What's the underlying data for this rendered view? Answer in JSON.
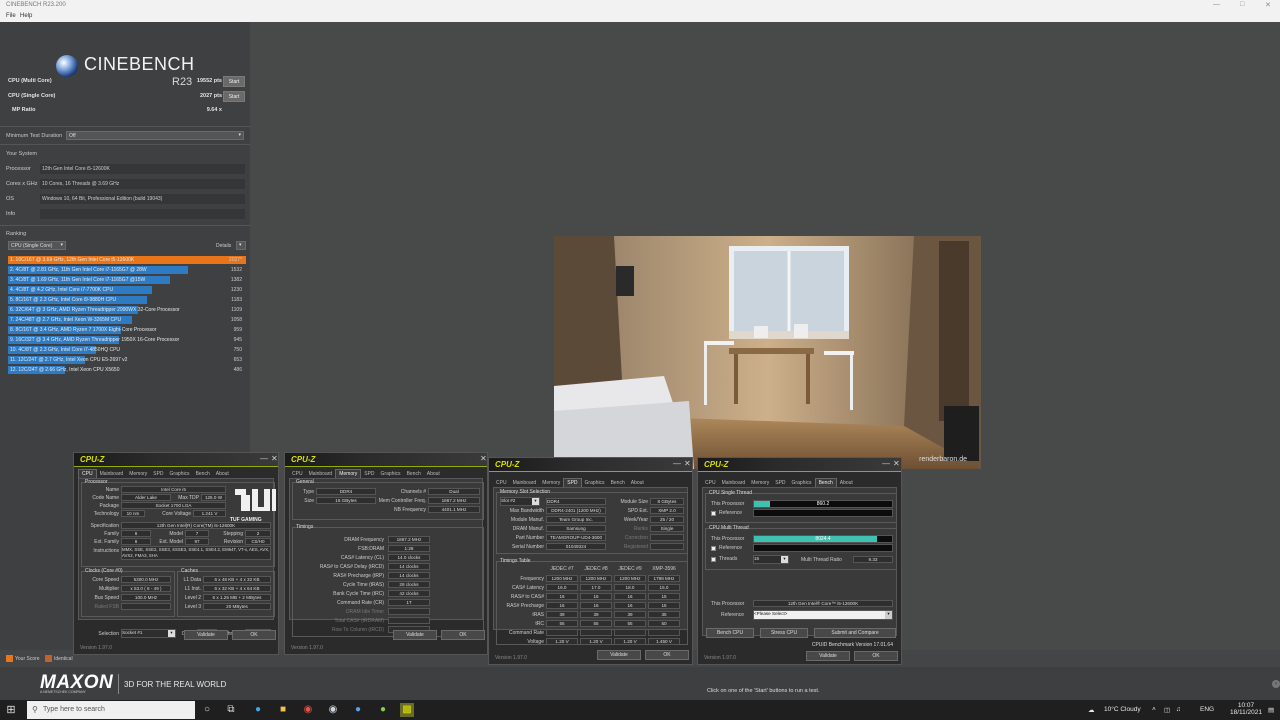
{
  "window": {
    "title": "CINEBENCH R23.200",
    "menu": [
      "File",
      "Help"
    ]
  },
  "logo": {
    "brand": "CINEBENCH",
    "version": "R23"
  },
  "scores": {
    "multi": {
      "label": "CPU (Multi Core)",
      "value": "19552 pts",
      "button": "Start"
    },
    "single": {
      "label": "CPU (Single Core)",
      "value": "2027 pts",
      "button": "Start"
    },
    "ratio": {
      "label": "MP Ratio",
      "value": "9.64 x"
    }
  },
  "min_duration": {
    "label": "Minimum Test Duration",
    "value": "Off"
  },
  "system": {
    "title": "Your System",
    "rows": [
      {
        "k": "Processor",
        "v": "12th Gen Intel Core i5-12600K"
      },
      {
        "k": "Cores x GHz",
        "v": "10 Cores, 16 Threads @ 3.69 GHz"
      },
      {
        "k": "OS",
        "v": "Windows 10, 64 Bit, Professional Edition (build 19043)"
      },
      {
        "k": "Info",
        "v": ""
      }
    ]
  },
  "ranking": {
    "title": "Ranking",
    "mode": "CPU (Single Core)",
    "details": "Details",
    "items": [
      {
        "label": "1. 10C/16T @ 3.69 GHz, 12th Gen Intel Core i5-12600K",
        "score": "2027*",
        "frac": 1.0,
        "color": "#e8751a"
      },
      {
        "label": "2. 4C/8T @ 2.81 GHz, 11th Gen Intel Core i7-1165G7 @ 28W",
        "score": "1532",
        "frac": 0.756,
        "color": "#2e7bc4"
      },
      {
        "label": "3. 4C/8T @ 1.69 GHz, 11th Gen Intel Core i7-1165G7 @15W",
        "score": "1382",
        "frac": 0.682,
        "color": "#2e7bc4"
      },
      {
        "label": "4. 4C/8T @ 4.2 GHz, Intel Core i7-7700K CPU",
        "score": "1230",
        "frac": 0.607,
        "color": "#2e7bc4"
      },
      {
        "label": "5. 8C/16T @ 2.3 GHz, Intel Core i9-9880H CPU",
        "score": "1183",
        "frac": 0.584,
        "color": "#2e7bc4"
      },
      {
        "label": "6. 32C/64T @ 3 GHz, AMD Ryzen Threadripper 2990WX 32-Core Processor",
        "score": "1109",
        "frac": 0.547,
        "color": "#2e7bc4"
      },
      {
        "label": "7. 24C/48T @ 2.7 GHz, Intel Xeon W-3265M CPU",
        "score": "1058",
        "frac": 0.522,
        "color": "#2e7bc4"
      },
      {
        "label": "8. 8C/16T @ 3.4 GHz, AMD Ryzen 7 1700X Eight-Core Processor",
        "score": "959",
        "frac": 0.473,
        "color": "#2e7bc4"
      },
      {
        "label": "9. 16C/32T @ 3.4 GHz, AMD Ryzen Threadripper 1950X 16-Core Processor",
        "score": "945",
        "frac": 0.466,
        "color": "#2e7bc4"
      },
      {
        "label": "10. 4C/8T @ 2.3 GHz, Intel Core i7-4850HQ CPU",
        "score": "750",
        "frac": 0.37,
        "color": "#2e7bc4"
      },
      {
        "label": "11. 12C/24T @ 2.7 GHz, Intel Xeon CPU E5-2697 v2",
        "score": "653",
        "frac": 0.322,
        "color": "#2e7bc4"
      },
      {
        "label": "12. 12C/24T @ 2.66 GHz, Intel Xeon CPU X5650",
        "score": "486",
        "frac": 0.24,
        "color": "#2e7bc4"
      }
    ]
  },
  "legend": {
    "your_score": "Your Score",
    "identical": "Identical",
    "your_color": "#e8751a",
    "identical_color": "#c0622a"
  },
  "render": {
    "watermark": "renderbaron.de"
  },
  "cpuz_cpu": {
    "title": "CPU-Z",
    "tabs": [
      "CPU",
      "Mainboard",
      "Memory",
      "SPD",
      "Graphics",
      "Bench",
      "About"
    ],
    "active": "CPU",
    "processor_title": "Processor",
    "name_l": "Name",
    "name": "Intel Core i5",
    "code_l": "Code Name",
    "code": "Alder Lake",
    "tdp_l": "Max TDP",
    "tdp": "125.0 W",
    "pkg_l": "Package",
    "pkg": "Socket 1700 LGA",
    "tech_l": "Technology",
    "tech": "10 nm",
    "volt_l": "Core Voltage",
    "volt": "1.241 V",
    "spec_l": "Specification",
    "spec": "12th Gen Intel(R) Core(TM) i5-12600K",
    "fam_l": "Family",
    "fam": "6",
    "model_l": "Model",
    "model": "7",
    "step_l": "Stepping",
    "step": "2",
    "efam_l": "Ext. Family",
    "efam": "6",
    "emodel_l": "Ext. Model",
    "emodel": "97",
    "rev_l": "Revision",
    "rev": "C0/H0",
    "inst_l": "Instructions",
    "inst": "MMX, SSE, SSE2, SSE3, SSSE3, SSE4.1, SSE4.2, EM64T, VT-x, AES, AVX, AVX2, FMA3, SHA",
    "clocks_title": "Clocks (Core #0)",
    "speed_l": "Core Speed",
    "speed": "5300.0 MHz",
    "mult_l": "Multiplier",
    "mult": "x 53.0 ( 8 - 49 )",
    "bus_l": "Bus Speed",
    "bus": "100.0 MHz",
    "fsb_l": "Rated FSB",
    "fsb": "",
    "caches_title": "Caches",
    "l1d_l": "L1 Data",
    "l1d": "6 x 48 KB + 4 x 32 KB",
    "l1i_l": "L1 Inst.",
    "l1i": "6 x 32 KB + 4 x 64 KB",
    "l2_l": "Level 2",
    "l2": "6 x 1.25 MB + 2 MBytes",
    "l3_l": "Level 3",
    "l3": "20 MBytes",
    "sel_l": "Selection",
    "sel": "Socket #1",
    "cores_l": "Cores",
    "cores": "6 + 4",
    "threads_l": "Threads",
    "threads": "16",
    "validate": "Validate",
    "ok": "OK",
    "version": "Version 1.97.0",
    "badge": "TUF GAMING"
  },
  "cpuz_mem": {
    "title": "CPU-Z",
    "tabs": [
      "CPU",
      "Mainboard",
      "Memory",
      "SPD",
      "Graphics",
      "Bench",
      "About"
    ],
    "active": "Memory",
    "general_title": "General",
    "type_l": "Type",
    "type": "DDR4",
    "ch_l": "Channels #",
    "ch": "Dual",
    "size_l": "Size",
    "size": "16 GBytes",
    "mcf_l": "Mem Controller Freq.",
    "mcf": "1867.2 MHz",
    "nbf_l": "NB Frequency",
    "nbf": "4401.1 MHz",
    "timings_title": "Timings",
    "rows": [
      {
        "l": "DRAM Frequency",
        "v": "1867.2 MHz"
      },
      {
        "l": "FSB:DRAM",
        "v": "1:28"
      },
      {
        "l": "CAS# Latency (CL)",
        "v": "14.0 clocks"
      },
      {
        "l": "RAS# to CAS# Delay (tRCD)",
        "v": "14 clocks"
      },
      {
        "l": "RAS# Precharge (tRP)",
        "v": "14 clocks"
      },
      {
        "l": "Cycle Time (tRAS)",
        "v": "28 clocks"
      },
      {
        "l": "Bank Cycle Time (tRC)",
        "v": "42 clocks"
      },
      {
        "l": "Command Rate (CR)",
        "v": "1T"
      },
      {
        "l": "DRAM Idle Timer",
        "v": ""
      },
      {
        "l": "Total CAS# (tRDRAM)",
        "v": ""
      },
      {
        "l": "Row To Column (tRCD)",
        "v": ""
      }
    ],
    "validate": "Validate",
    "ok": "OK",
    "version": "Version 1.97.0"
  },
  "cpuz_spd": {
    "title": "CPU-Z",
    "tabs": [
      "CPU",
      "Mainboard",
      "Memory",
      "SPD",
      "Graphics",
      "Bench",
      "About"
    ],
    "active": "SPD",
    "slot_title": "Memory Slot Selection",
    "slot": "Slot #2",
    "slot_type": "DDR4",
    "modsize_l": "Module Size",
    "modsize": "8 GBytes",
    "maxbw_l": "Max Bandwidth",
    "maxbw": "DDR4-2401 (1200 MHz)",
    "spdext_l": "SPD Ext.",
    "spdext": "XMP 2.0",
    "modman_l": "Module Manuf.",
    "modman": "Team Group Inc.",
    "wy_l": "Week/Year",
    "wy": "25 / 20",
    "dram_l": "DRAM Manuf.",
    "dram": "Samsung",
    "ranks_l": "Ranks",
    "ranks": "Single",
    "part_l": "Part Number",
    "part": "TEAMGROUP-UD4-3600",
    "corr_l": "Correction",
    "corr": "",
    "serial_l": "Serial Number",
    "serial": "01049324",
    "reg_l": "Registered",
    "reg": "",
    "tt_title": "Timings Table",
    "cols": [
      "JEDEC #7",
      "JEDEC #8",
      "JEDEC #9",
      "XMP-3596"
    ],
    "trows": [
      {
        "l": "Frequency",
        "v": [
          "1200 MHz",
          "1200 MHz",
          "1200 MHz",
          "1798 MHz"
        ]
      },
      {
        "l": "CAS# Latency",
        "v": [
          "16.0",
          "17.0",
          "18.0",
          "15.0"
        ]
      },
      {
        "l": "RAS# to CAS#",
        "v": [
          "16",
          "16",
          "16",
          "15"
        ]
      },
      {
        "l": "RAS# Precharge",
        "v": [
          "16",
          "16",
          "16",
          "15"
        ]
      },
      {
        "l": "tRAS",
        "v": [
          "39",
          "39",
          "39",
          "35"
        ]
      },
      {
        "l": "tRC",
        "v": [
          "55",
          "55",
          "55",
          "50"
        ]
      },
      {
        "l": "Command Rate",
        "v": [
          "",
          "",
          "",
          ""
        ]
      },
      {
        "l": "Voltage",
        "v": [
          "1.20 V",
          "1.20 V",
          "1.20 V",
          "1.450 V"
        ]
      }
    ],
    "validate": "Validate",
    "ok": "OK",
    "version": "Version 1.97.0"
  },
  "cpuz_bench": {
    "title": "CPU-Z",
    "tabs": [
      "CPU",
      "Mainboard",
      "Memory",
      "SPD",
      "Graphics",
      "Bench",
      "About"
    ],
    "active": "Bench",
    "st_title": "CPU Single Thread",
    "this_l": "This Processor",
    "st": "860.2",
    "st_frac": 0.115,
    "ref_l": "Reference",
    "mt_title": "CPU Multi Thread",
    "mt": "8024.4",
    "mt_frac": 0.89,
    "threads_l": "Threads",
    "threads": "16",
    "mtr_l": "Multi Thread Ratio",
    "mtr": "9.33",
    "tp_l": "This Processor",
    "tp": "12th Gen Intel® Core™ i5-12600K",
    "rs_l": "Reference",
    "rs": "<Please Select>",
    "bench_btn": "Bench CPU",
    "stress_btn": "Stress CPU",
    "submit_btn": "Submit and Compare",
    "bver": "CPUID Benchmark Version 17.01.64",
    "validate": "Validate",
    "ok": "OK",
    "version": "Version 1.97.0",
    "bar_color": "#40c0b0"
  },
  "footer": {
    "brand": "MAXON",
    "sub": "A NEMETSCHEK COMPANY",
    "tagline": "3D FOR THE REAL WORLD",
    "hint": "Click on one of the 'Start' buttons to run a test."
  },
  "taskbar": {
    "search": "Type here to search",
    "weather": "10°C Cloudy",
    "lang": "ENG",
    "time": "10:07",
    "date": "18/11/2021"
  }
}
